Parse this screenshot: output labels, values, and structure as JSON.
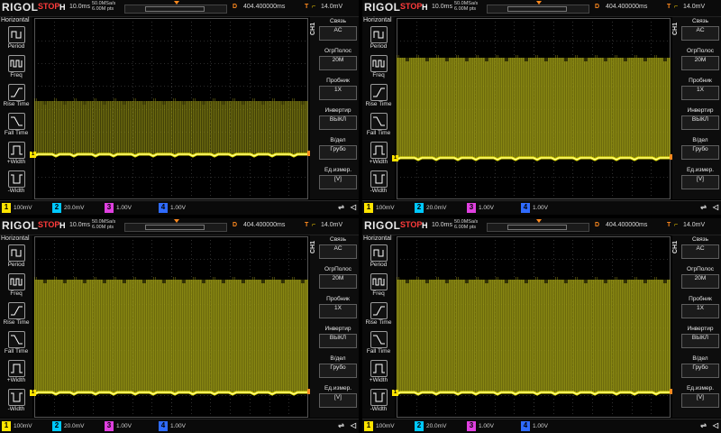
{
  "colors": {
    "trace": "#e8e500",
    "trace_fill": "#8f8c10",
    "grid": "#3a3a3a",
    "stop": "#ff3b3b",
    "orange": "#ff8a1e",
    "ch1": "#ffe400",
    "ch2": "#00c8ff",
    "ch3": "#e040e0",
    "ch4": "#2f6bff"
  },
  "topbar": {
    "logo": "RIGOL",
    "status": "STOP",
    "h_label": "H",
    "timebase": "10.0ms",
    "sample_rate": "50.0MSa/s",
    "mem_depth": "6.00M pts",
    "d_label": "D",
    "delay": "404.400000ms",
    "t_label": "T",
    "trig_level": "14.0mV"
  },
  "side": {
    "title": "Horizontal",
    "buttons": [
      {
        "label": "Period",
        "icon": "period-icon"
      },
      {
        "label": "Freq",
        "icon": "freq-icon"
      },
      {
        "label": "Rise Time",
        "icon": "rise-time-icon"
      },
      {
        "label": "Fall Time",
        "icon": "fall-time-icon"
      },
      {
        "label": "+Width",
        "icon": "plus-width-icon"
      },
      {
        "label": "-Width",
        "icon": "minus-width-icon"
      }
    ]
  },
  "right_menu": {
    "tab": "CH1",
    "items": [
      {
        "title": "Связь",
        "value": "AC"
      },
      {
        "title": "ОгрПолос",
        "value": "20M"
      },
      {
        "title": "Пробник",
        "value": "1X"
      },
      {
        "title": "Инвертир",
        "value": "ВЫКЛ"
      },
      {
        "title": "В/дел",
        "value": "Грубо"
      },
      {
        "title": "Ед.измер.",
        "value": "[V]"
      }
    ]
  },
  "bottombar": {
    "channels": [
      {
        "num": "1",
        "value": "100mV",
        "color": "#ffe400"
      },
      {
        "num": "2",
        "value": "20.0mV",
        "color": "#00c8ff"
      },
      {
        "num": "3",
        "value": "1.00V",
        "color": "#e040e0"
      },
      {
        "num": "4",
        "value": "1.00V",
        "color": "#2f6bff"
      }
    ],
    "usb": "⇌",
    "speaker": "◁"
  },
  "panels": [
    {
      "name": "scope-panel-1",
      "band_top": 0.46,
      "baseline": 0.75
    },
    {
      "name": "scope-panel-2",
      "band_top": 0.22,
      "baseline": 0.77
    },
    {
      "name": "scope-panel-3",
      "band_top": 0.24,
      "baseline": 0.86
    },
    {
      "name": "scope-panel-4",
      "band_top": 0.24,
      "baseline": 0.86
    }
  ]
}
